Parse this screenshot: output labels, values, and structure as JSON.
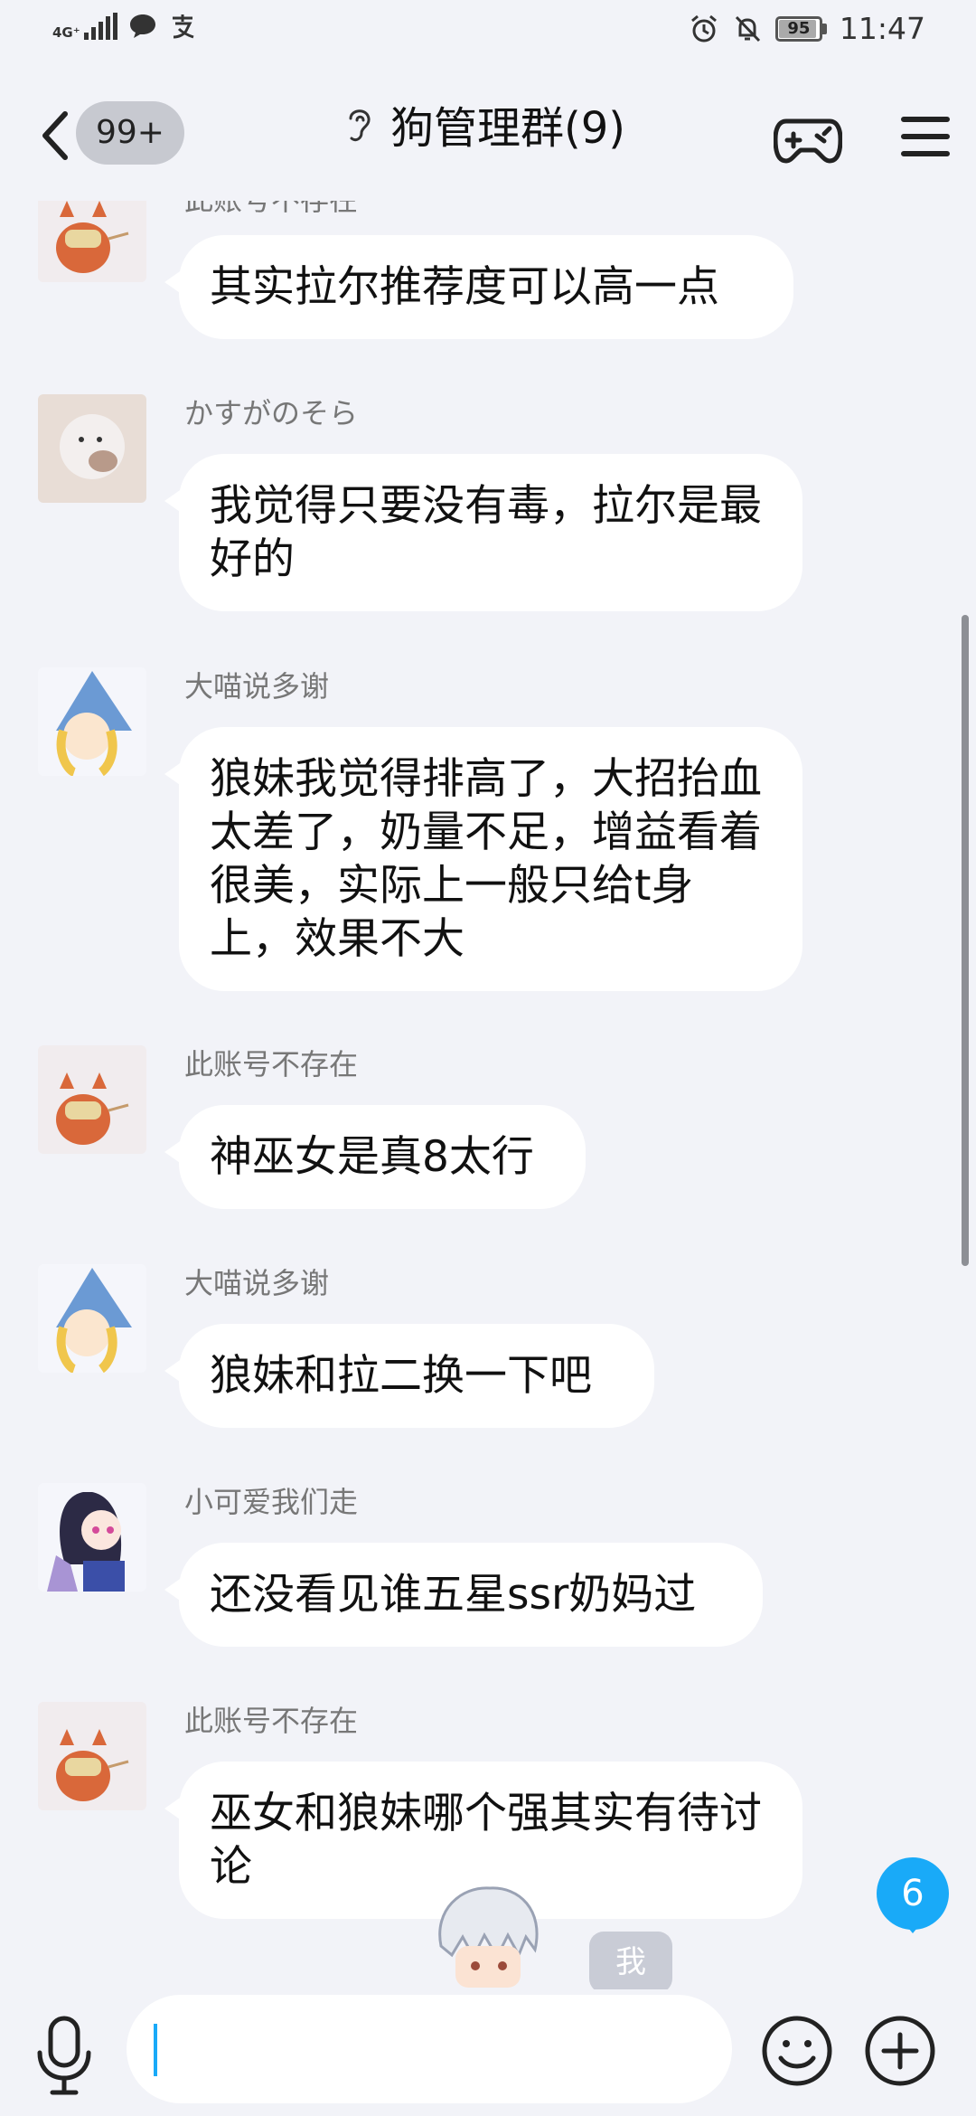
{
  "status_bar": {
    "network": "4G⁺",
    "network_sub": "⁴ᴳ",
    "battery": "95",
    "time": "11:47",
    "icons": [
      "signal-icon",
      "message-icon",
      "alipay-icon",
      "alarm-icon",
      "mute-icon",
      "battery-icon"
    ]
  },
  "header": {
    "unread": "99+",
    "title": "狗管理群(9)"
  },
  "messages": [
    {
      "sender": "此账号不存在",
      "text": "其实拉尔推荐度可以高一点"
    },
    {
      "sender": "かすがのそら",
      "text": "我觉得只要没有毒，拉尔是最好的"
    },
    {
      "sender": "大喵说多谢",
      "text": "狼妹我觉得排高了，大招抬血太差了，奶量不足，增益看着很美，实际上一般只给t身上，效果不大"
    },
    {
      "sender": "此账号不存在",
      "text": "神巫女是真8太行"
    },
    {
      "sender": "大喵说多谢",
      "text": "狼妹和拉二换一下吧"
    },
    {
      "sender": "小可爱我们走",
      "text": "还没看见谁五星ssr奶妈过"
    },
    {
      "sender": "此账号不存在",
      "text": "巫女和狼妹哪个强其实有待讨论"
    }
  ],
  "new_count": "6",
  "me_label": "我",
  "colors": {
    "accent": "#19aaf8",
    "background": "#f2f3f8",
    "bubble": "#ffffff"
  }
}
